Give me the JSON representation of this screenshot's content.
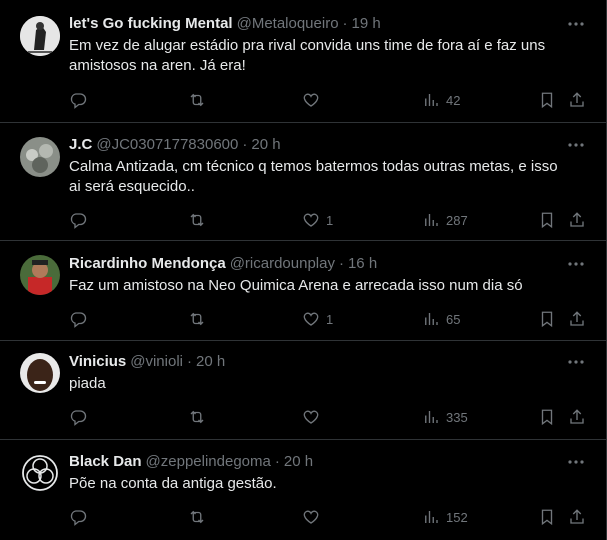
{
  "tweets": [
    {
      "name": "let's Go fucking Mental",
      "handle": "@Metaloqueiro",
      "sep": "·",
      "time": "19 h",
      "text": "Em vez de alugar estádio pra rival convida uns time de fora aí e faz uns amistosos na aren. Já era!",
      "likes": "",
      "views": "42",
      "avatar_color": "#555"
    },
    {
      "name": "J.C",
      "handle": "@JC0307177830600",
      "sep": "·",
      "time": "20 h",
      "text": "Calma Antizada, cm técnico q temos batermos todas outras metas, e isso ai será esquecido..",
      "likes": "1",
      "views": "287",
      "avatar_color": "#7b7f7a"
    },
    {
      "name": "Ricardinho Mendonça",
      "handle": "@ricardounplay",
      "sep": "·",
      "time": "16 h",
      "text": "Faz um amistoso na Neo Quimica Arena e arrecada isso num dia só",
      "likes": "1",
      "views": "65",
      "avatar_color": "#b52a2a"
    },
    {
      "name": "Vinicius",
      "handle": "@vinioli",
      "sep": "·",
      "time": "20 h",
      "text": "piada",
      "likes": "",
      "views": "335",
      "avatar_color": "#3b2418"
    },
    {
      "name": "Black Dan",
      "handle": "@zeppelindegoma",
      "sep": "·",
      "time": "20 h",
      "text": "Põe na conta da antiga gestão.",
      "likes": "",
      "views": "152",
      "avatar_color": "#000"
    }
  ],
  "icons": {
    "more": "more-icon",
    "reply": "reply-icon",
    "retweet": "retweet-icon",
    "like": "heart-icon",
    "views": "views-icon",
    "bookmark": "bookmark-icon",
    "share": "share-icon"
  },
  "colors": {
    "background": "#000000",
    "text": "#e7e9ea",
    "muted": "#71767b",
    "divider": "#2f3336"
  }
}
